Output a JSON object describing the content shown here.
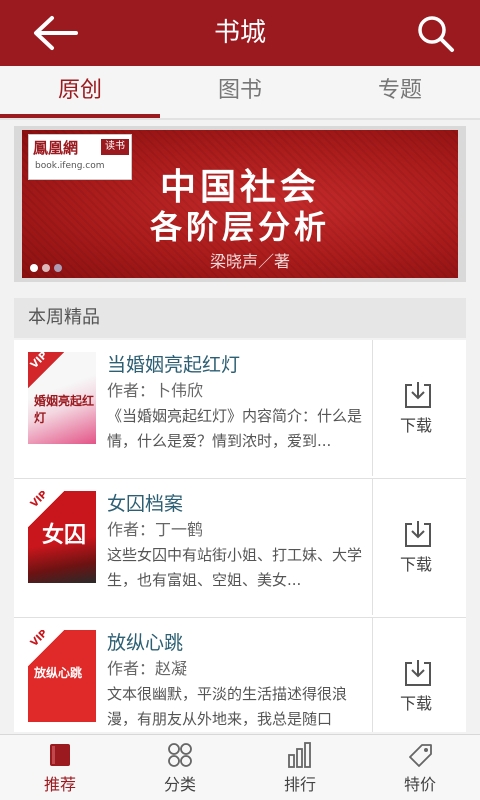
{
  "header": {
    "title": "书城"
  },
  "tabs": [
    {
      "label": "原创",
      "active": true
    },
    {
      "label": "图书",
      "active": false
    },
    {
      "label": "专题",
      "active": false
    }
  ],
  "banner": {
    "logo": "鳳凰網",
    "logo_badge": "读书",
    "logo_url": "book.ifeng.com",
    "line1": "中国社会",
    "line2": "各阶层分析",
    "author": "梁晓声／著",
    "dots": 3,
    "active_dot": 1
  },
  "section": {
    "title": "本周精品"
  },
  "books": [
    {
      "title": "当婚姻亮起红灯",
      "author": "作者：卜伟欣",
      "desc": "《当婚姻亮起红灯》内容简介：什么是情，什么是爱？情到浓时，爱到...",
      "cover_text": "婚姻亮起红灯",
      "download": "下载",
      "vip": "VIP"
    },
    {
      "title": "女囚档案",
      "author": "作者：丁一鹤",
      "desc": "这些女囚中有站街小姐、打工妹、大学生，也有富姐、空姐、美女...",
      "cover_text": "女囚",
      "download": "下载",
      "vip": "VIP"
    },
    {
      "title": "放纵心跳",
      "author": "作者：赵凝",
      "desc": "文本很幽默，平淡的生活描述得很浪漫，有朋友从外地来，我总是随口",
      "cover_text": "放纵心跳",
      "download": "下载",
      "vip": "VIP"
    }
  ],
  "bottom_nav": [
    {
      "label": "推荐",
      "icon": "book-icon",
      "active": true
    },
    {
      "label": "分类",
      "icon": "grid-circles-icon",
      "active": false
    },
    {
      "label": "排行",
      "icon": "bar-chart-icon",
      "active": false
    },
    {
      "label": "特价",
      "icon": "tag-icon",
      "active": false
    }
  ],
  "colors": {
    "brand": "#9b1a1f",
    "title_link": "#2c5f73",
    "background": "#f2f2f2"
  }
}
